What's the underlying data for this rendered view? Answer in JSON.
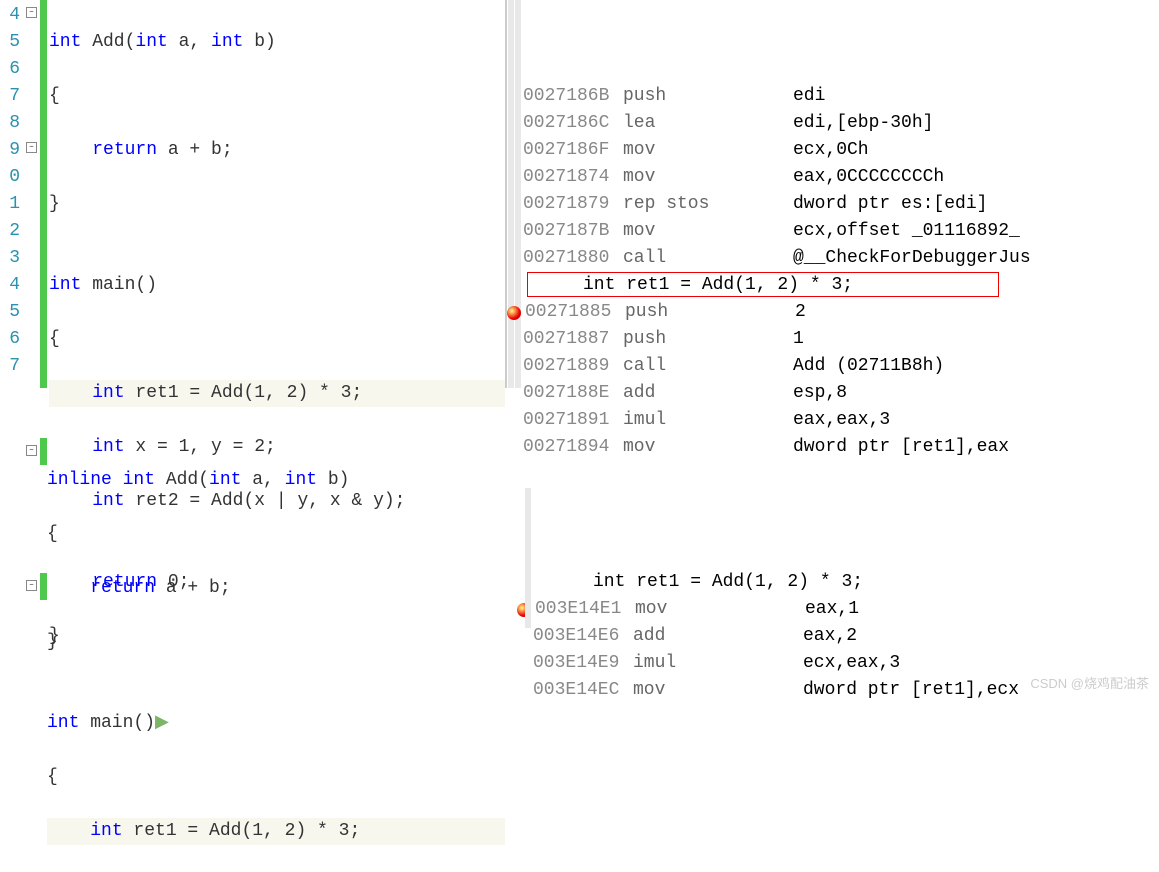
{
  "top": {
    "line_numbers": [
      "4",
      "5",
      "6",
      "7",
      "8",
      "9",
      "0",
      "1",
      "2",
      "3",
      "4",
      "5",
      "6",
      "7"
    ],
    "code": {
      "l1": {
        "t1": "int",
        "t2": " Add(",
        "t3": "int",
        "t4": " a, ",
        "t5": "int",
        "t6": " b)"
      },
      "l2": "{",
      "l3": {
        "t1": "    ",
        "t2": "return",
        "t3": " a + b;"
      },
      "l4": "}",
      "l5": "",
      "l6": {
        "t1": "int",
        "t2": " main()"
      },
      "l7": "{",
      "l8": {
        "t1": "    ",
        "t2": "int",
        "t3": " ret1 = Add(1, 2) * 3;"
      },
      "l9": "",
      "l10": {
        "t1": "    ",
        "t2": "int",
        "t3": " x = 1, y = 2;"
      },
      "l11": {
        "t1": "    ",
        "t2": "int",
        "t3": " ret2 = Add(x | y, x & y);"
      },
      "l12": "",
      "l13": {
        "t1": "    ",
        "t2": "return",
        "t3": " 0;"
      },
      "l14": "}"
    },
    "asm": [
      {
        "addr": "0027186B",
        "op": "push",
        "args": "edi"
      },
      {
        "addr": "0027186C",
        "op": "lea",
        "args": "edi,[ebp-30h]"
      },
      {
        "addr": "0027186F",
        "op": "mov",
        "args": "ecx,0Ch"
      },
      {
        "addr": "00271874",
        "op": "mov",
        "args": "eax,0CCCCCCCCh"
      },
      {
        "addr": "00271879",
        "op": "rep stos",
        "args": "dword ptr es:[edi]"
      },
      {
        "addr": "0027187B",
        "op": "mov",
        "args": "ecx,offset _01116892_"
      },
      {
        "addr": "00271880",
        "op": "call",
        "args": "@__CheckForDebuggerJus"
      },
      {
        "src": "int ret1 = Add(1, 2) * 3;"
      },
      {
        "addr": "00271885",
        "op": "push",
        "args": "2",
        "bp": true
      },
      {
        "addr": "00271887",
        "op": "push",
        "args": "1"
      },
      {
        "addr": "00271889",
        "op": "call",
        "args": "Add (02711B8h)",
        "highlight": true
      },
      {
        "addr": "0027188E",
        "op": "add",
        "args": "esp,8"
      },
      {
        "addr": "00271891",
        "op": "imul",
        "args": "eax,eax,3"
      },
      {
        "addr": "00271894",
        "op": "mov",
        "args": "dword ptr [ret1],eax"
      }
    ]
  },
  "bottom": {
    "code": {
      "l1": {
        "t1": "inline",
        "t2": " ",
        "t3": "int",
        "t4": " Add(",
        "t5": "int",
        "t6": " a, ",
        "t7": "int",
        "t8": " b)"
      },
      "l2": "{",
      "l3": {
        "t1": "    ",
        "t2": "return",
        "t3": " a + b;"
      },
      "l4": "}",
      "l5": "",
      "l6": {
        "t1": "int",
        "t2": " main()",
        "arrow": "▶"
      },
      "l7": "{",
      "l8": {
        "t1": "    ",
        "t2": "int",
        "t3": " ret1 = Add(1, 2) * 3;"
      }
    },
    "asm": [
      {
        "src": "int ret1 = Add(1, 2) * 3;"
      },
      {
        "addr": "003E14E1",
        "op": "mov",
        "args": "eax,1",
        "bp": true
      },
      {
        "addr": "003E14E6",
        "op": "add",
        "args": "eax,2"
      },
      {
        "addr": "003E14E9",
        "op": "imul",
        "args": "ecx,eax,3"
      },
      {
        "addr": "003E14EC",
        "op": "mov",
        "args": "dword ptr [ret1],ecx"
      }
    ]
  },
  "watermark": "CSDN @烧鸡配油茶"
}
